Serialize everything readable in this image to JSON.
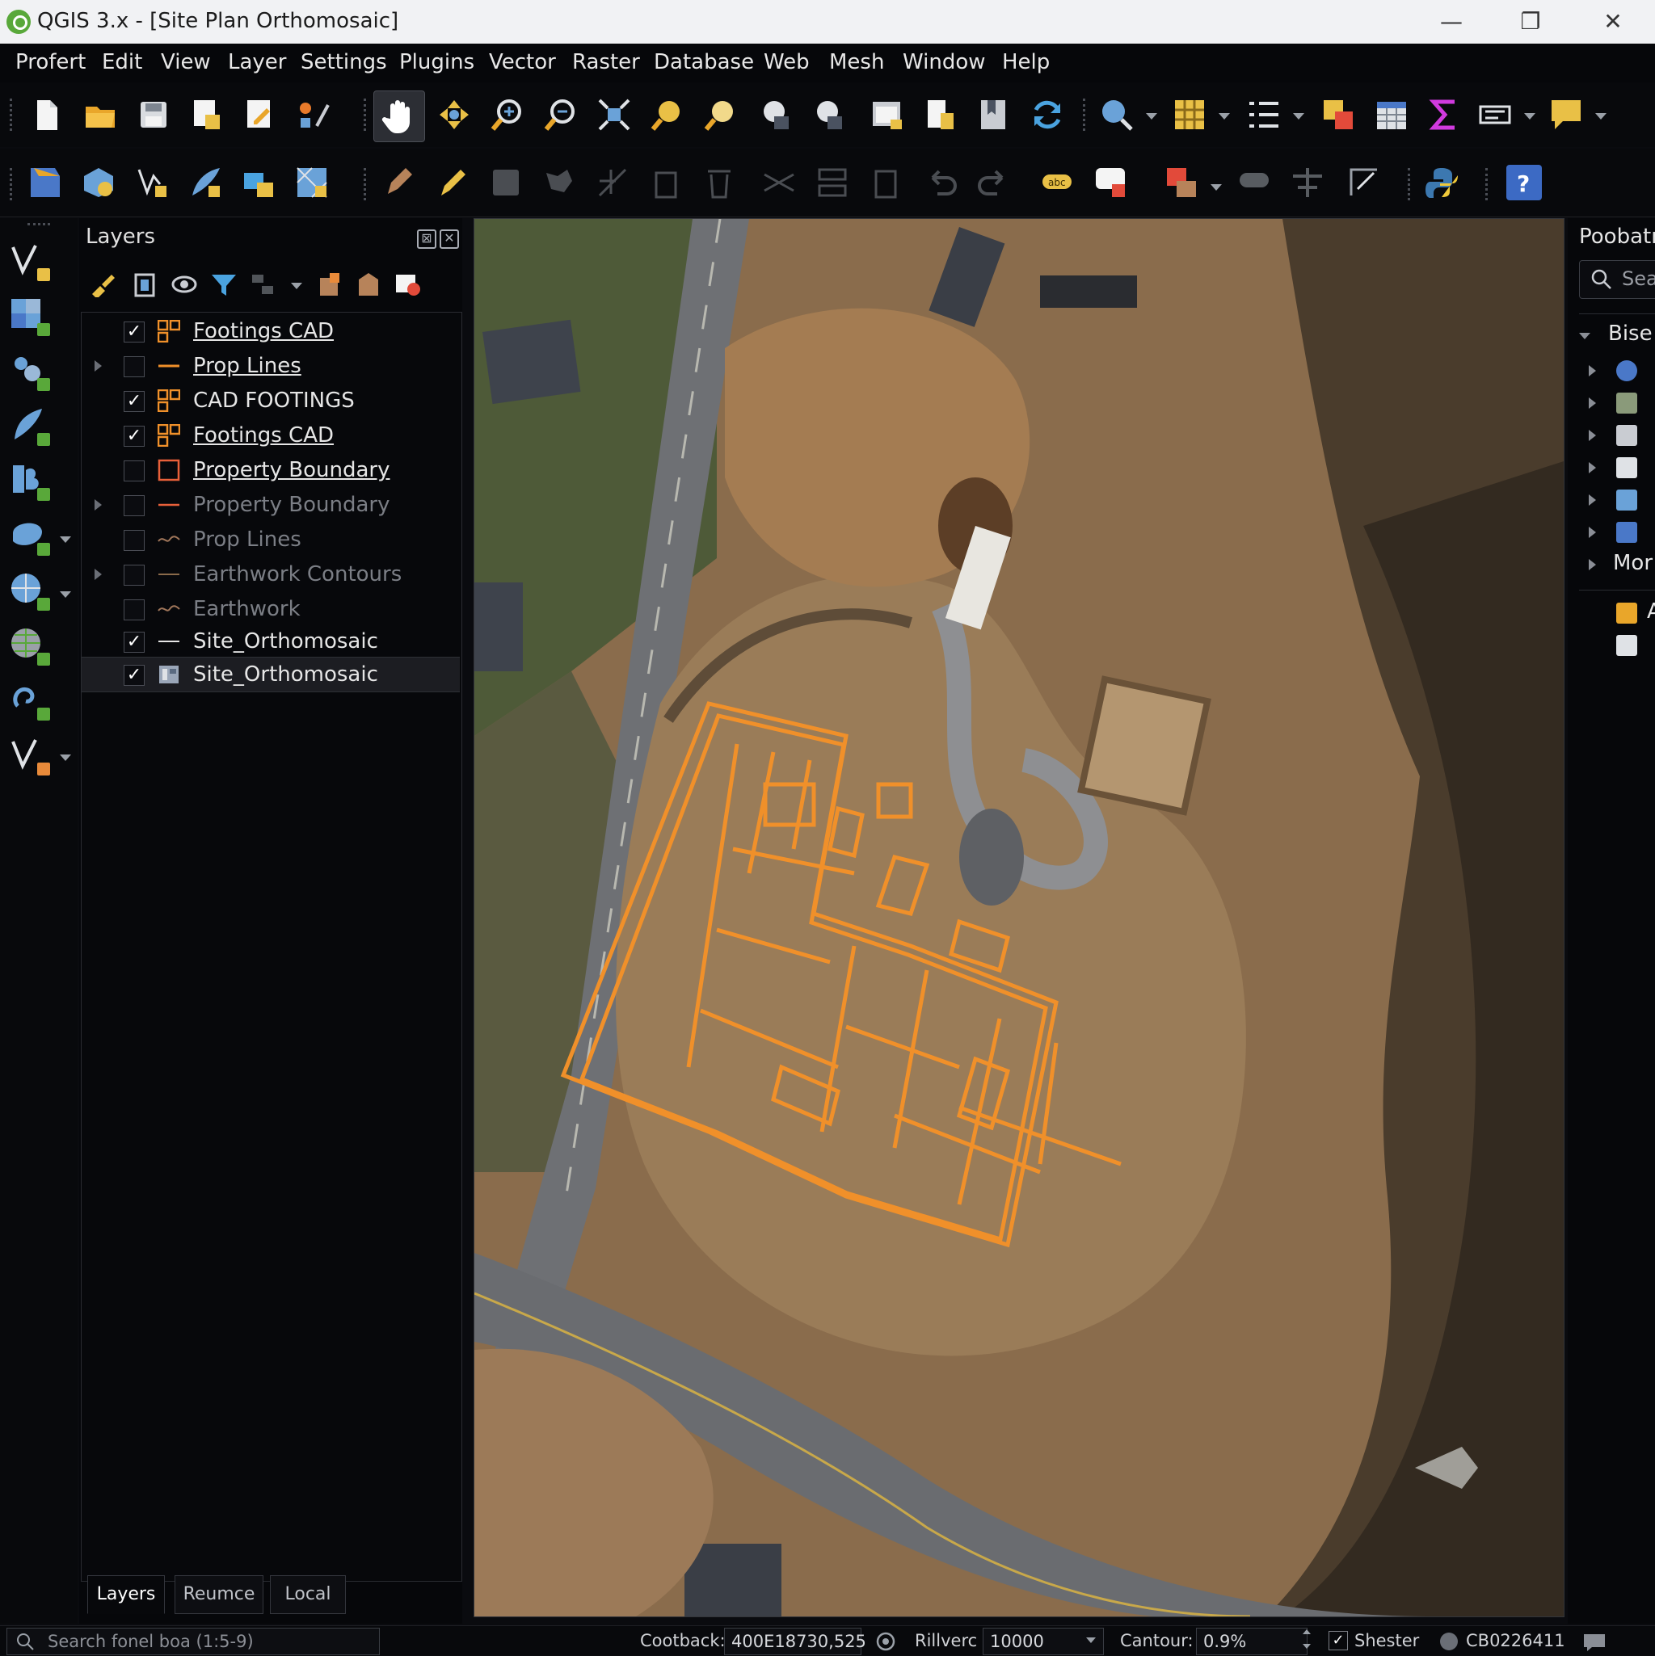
{
  "window": {
    "title": "QGIS 3.x - [Site Plan Orthomosaic]",
    "controls": [
      "—",
      "❐",
      "✕"
    ]
  },
  "menu": [
    "Profert",
    "Edit",
    "View",
    "Layer",
    "Settings",
    "Plugins",
    "Vector",
    "Raster",
    "Database",
    "Web",
    "Mesh",
    "Window",
    "Help"
  ],
  "layers_panel": {
    "title": "Layers",
    "layers": [
      {
        "name": "Footings CAD",
        "checked": true,
        "style": "polygon-grid",
        "expandable": false,
        "underlined": true,
        "dimmed": false
      },
      {
        "name": "Prop Lines",
        "checked": false,
        "style": "line",
        "expandable": true,
        "underlined": true,
        "dimmed": false
      },
      {
        "name": "CAD FOOTINGS",
        "checked": true,
        "style": "polygon-grid",
        "expandable": false,
        "underlined": false,
        "dimmed": false
      },
      {
        "name": "Footings CAD",
        "checked": true,
        "style": "polygon-grid",
        "expandable": false,
        "underlined": true,
        "dimmed": false
      },
      {
        "name": "Property Boundary",
        "checked": false,
        "style": "polygon",
        "expandable": false,
        "underlined": true,
        "dimmed": false
      },
      {
        "name": "Property Boundary",
        "checked": false,
        "style": "line",
        "expandable": true,
        "underlined": false,
        "dimmed": true
      },
      {
        "name": "Prop Lines",
        "checked": false,
        "style": "wave",
        "expandable": false,
        "underlined": false,
        "dimmed": true
      },
      {
        "name": "Earthwork Contours",
        "checked": false,
        "style": "line",
        "expandable": true,
        "underlined": false,
        "dimmed": true
      },
      {
        "name": "Earthwork",
        "checked": false,
        "style": "wave",
        "expandable": false,
        "underlined": false,
        "dimmed": true
      },
      {
        "name": "Site_Orthomosaic",
        "checked": true,
        "style": "white-line",
        "expandable": false,
        "underlined": false,
        "dimmed": false
      },
      {
        "name": "Site_Orthomosaic",
        "checked": true,
        "style": "raster",
        "expandable": false,
        "underlined": false,
        "dimmed": false,
        "selected": true
      }
    ],
    "tabs": [
      "Layers",
      "Reumce",
      "Local"
    ]
  },
  "right_panel": {
    "title": "Poobatr",
    "search_placeholder": "Sea",
    "group": "Bise",
    "more": "Mor",
    "extra_item": "A"
  },
  "status": {
    "search_placeholder": "Search fonel boa (1:5-9)",
    "coord_label": "Cootback:",
    "coord_value": "400E18730,525",
    "scale_label": "Rillverc",
    "scale_value": "10000",
    "rotation_label": "Cantour:",
    "rotation_value": "0.9%",
    "render_label": "Shester",
    "crs": "CB0226411"
  },
  "colors": {
    "accent_orange": "#f0902a",
    "panel_bg": "#06070a",
    "title_bg": "#f1f2f4"
  }
}
